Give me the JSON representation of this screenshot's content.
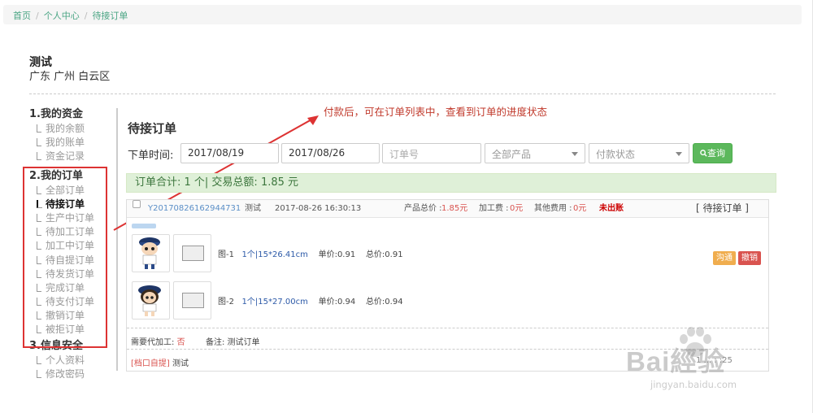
{
  "breadcrumb": [
    "首页",
    "个人中心",
    "待接订单"
  ],
  "user": {
    "name": "测试",
    "location": "广东 广州 白云区"
  },
  "sidebar": {
    "groups": [
      {
        "title": "1.我的资金",
        "items": [
          "我的余额",
          "我的账单",
          "资金记录"
        ]
      },
      {
        "title": "2.我的订单",
        "items": [
          "全部订单",
          "待接订单",
          "生产中订单",
          "待加工订单",
          "加工中订单",
          "待自提订单",
          "待发货订单",
          "完成订单",
          "待支付订单",
          "撤销订单",
          "被拒订单"
        ]
      },
      {
        "title": "3.信息安全",
        "items": [
          "个人资料",
          "修改密码"
        ]
      }
    ],
    "active_item": "待接订单"
  },
  "annotation": "付款后，可在订单列表中，查看到订单的进度状态",
  "main": {
    "title": "待接订单",
    "filter": {
      "label": "下单时间:",
      "date_from": "2017/08/19",
      "date_to": "2017/08/26",
      "order_no_placeholder": "订单号",
      "product_select": "全部产品",
      "pay_status_select": "付款状态",
      "query_label": "查询"
    },
    "summary": "订单合计: 1 个| 交易总额: 1.85 元"
  },
  "order": {
    "order_no": "Y20170826162944731",
    "customer": "测试",
    "time": "2017-08-26 16:30:13",
    "product_total_label": "产品总价 :",
    "product_total": "1.85元",
    "processing_fee_label": "加工费 :",
    "processing_fee": "0元",
    "other_fee_label": "其他费用 :",
    "other_fee": "0元",
    "shipping_status": "未出账",
    "status_tag": "[ 待接订单 ]",
    "items": [
      {
        "name": "图-1",
        "spec": "1个|15*26.41cm",
        "unit_price": "单价:0.91",
        "total_price": "总价:0.91"
      },
      {
        "name": "图-2",
        "spec": "1个|15*27.00cm",
        "unit_price": "单价:0.94",
        "total_price": "总价:0.94"
      }
    ],
    "btn_contact": "沟通",
    "btn_cancel": "撤销",
    "need_processing_label": "需要代加工:",
    "need_processing": "否",
    "remark": "备注: 测试订单",
    "pickup_tag": "[档口自提]",
    "pickup_name": "测试",
    "footer_right": "1 ... :  :25"
  },
  "watermark": {
    "brand": "Bai經验",
    "url": "jingyan.baidu.com"
  }
}
